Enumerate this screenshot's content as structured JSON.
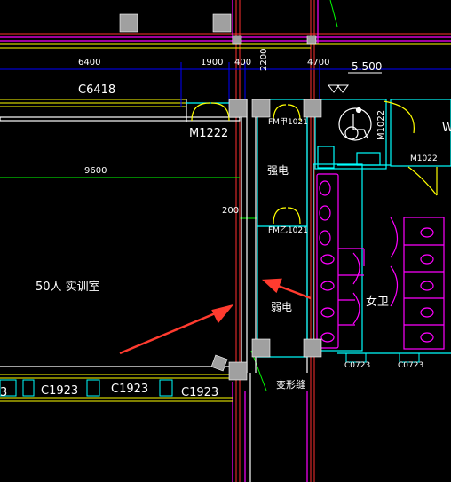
{
  "dimensions": {
    "d1": "6400",
    "d2": "1900",
    "d3": "400",
    "d4": "2200",
    "d5": "4700",
    "d6": "9600",
    "d7": "200"
  },
  "labels": {
    "window_top": "C6418",
    "door_main": "M1222",
    "room_main": "50人  实训室",
    "fm_top": "FM甲1021",
    "fm_mid": "FM乙1021",
    "strong_elec": "强电",
    "weak_elec": "弱电",
    "door_acc": "M1022",
    "door_wc": "M1022",
    "womens": "女卫",
    "level": "5.500",
    "win_bottom_1": "C1923",
    "win_bottom_2": "C1923",
    "win_bottom_3": "C1923",
    "win_wc_1": "C0723",
    "win_wc_2": "C0723",
    "joint": "变形缝",
    "edge_w": "W",
    "edge_3": "3"
  },
  "colors": {
    "background": "#000000",
    "wall": "#ffffff",
    "axis": "#ff3030",
    "magenta": "#ff00ff",
    "cyan": "#00ffff",
    "yellow": "#ffff00",
    "green": "#00ff00",
    "dim_blue": "#0000ff",
    "column": "#a0a0a0",
    "arrow": "#ff3b2f"
  }
}
